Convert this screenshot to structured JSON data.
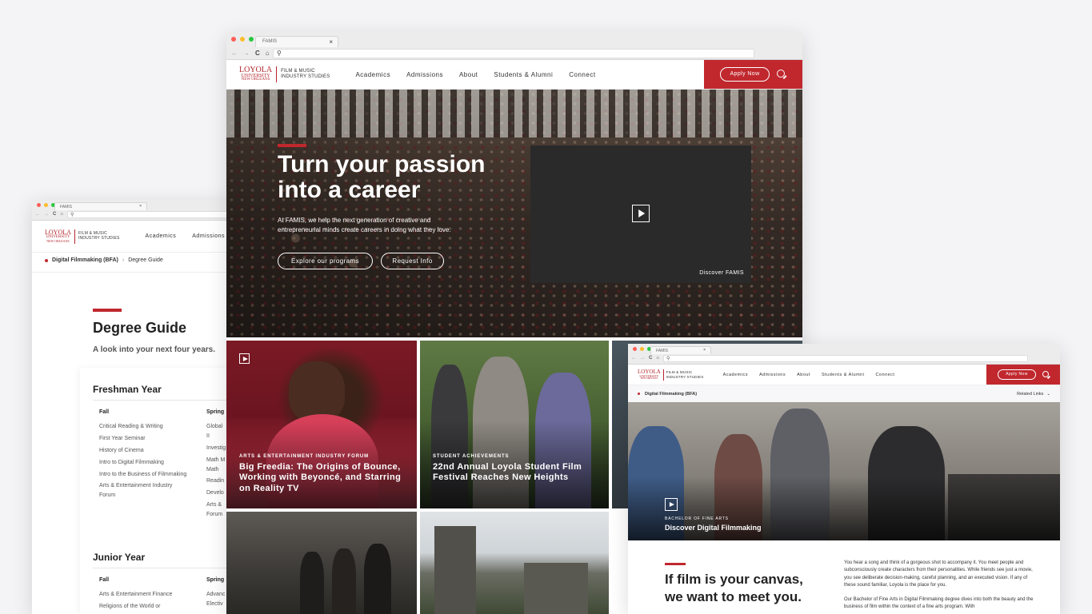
{
  "browser": {
    "tab_title": "FAMIS",
    "tab_close": "×",
    "nav_glyphs": {
      "back": "←",
      "forward": "→",
      "reload": "C",
      "home": "⌂",
      "search": "⚲"
    }
  },
  "colors": {
    "brand_red": "#c0282e",
    "text_dark": "#222222",
    "page_bg": "#f4f4f6"
  },
  "logo": {
    "line1": "LOYOLA",
    "line2": "UNIVERSITY",
    "line3": "NEW ORLEANS",
    "famis_line1": "FILM & MUSIC",
    "famis_line2": "INDUSTRY STUDIES"
  },
  "nav": {
    "items": [
      "Academics",
      "Admissions",
      "About",
      "Students & Alumni",
      "Connect"
    ],
    "apply_label": "Apply Now"
  },
  "hero": {
    "title_line1": "Turn your passion",
    "title_line2": "into a career",
    "body": "At FAMIS, we help the next generation of creative and entrepreneurial minds create careers in doing what they love.",
    "button_programs": "Explore our programs",
    "button_request": "Request Info",
    "video_caption": "Discover FAMIS"
  },
  "cards": [
    {
      "category": "ARTS & ENTERTAINMENT INDUSTRY FORUM",
      "title": "Big Freedia: The Origins of Bounce, Working with Beyoncé, and Starring on Reality TV"
    },
    {
      "category": "STUDENT ACHIEVEMENTS",
      "title": "22nd Annual Loyola Student Film Festival Reaches New Heights"
    }
  ],
  "left_page": {
    "breadcrumb_parent": "Digital Filmmaking (BFA)",
    "breadcrumb_sep": "›",
    "breadcrumb_current": "Degree Guide",
    "title": "Degree Guide",
    "subtitle": "A look into your next four years.",
    "freshman_heading": "Freshman Year",
    "fall_label": "Fall",
    "spring_label": "Spring",
    "freshman_fall": [
      "Critical Reading & Writing",
      "First Year Seminar",
      "History of Cinema",
      "Intro to Digital Filmmaking",
      "Intro to the Business of Filmmaking",
      "Arts & Entertainment Industry Forum"
    ],
    "freshman_spring": [
      "Global",
      "II",
      "Investig",
      "Math M",
      "Math",
      "Readin",
      "Develo",
      "Arts &",
      "Forum"
    ],
    "junior_heading": "Junior Year",
    "junior_fall": [
      "Arts & Entertainment Finance",
      "Religions of the World or"
    ],
    "junior_spring": [
      "Advanc",
      "Electiv"
    ]
  },
  "right_page": {
    "breadcrumb": "Digital Filmmaking (BFA)",
    "related_links": "Related Links",
    "related_chevron": "⌄",
    "hero_category": "BACHELOR OF FINE ARTS",
    "hero_title": "Discover Digital Filmmaking",
    "headline_line1": "If film is your canvas,",
    "headline_line2": "we want to meet you.",
    "para1": "You hear a song and think of a gorgeous shot to accompany it. You meet people and subconsciously create characters from their personalities. While friends see just a movie, you see deliberate decision-making, careful planning, and an executed vision. If any of these sound familiar, Loyola is the place for you.",
    "para2": "Our Bachelor of Fine Arts in Digital Filmmaking degree dives into both the beauty and the business of film within the context of a fine arts program. With"
  }
}
